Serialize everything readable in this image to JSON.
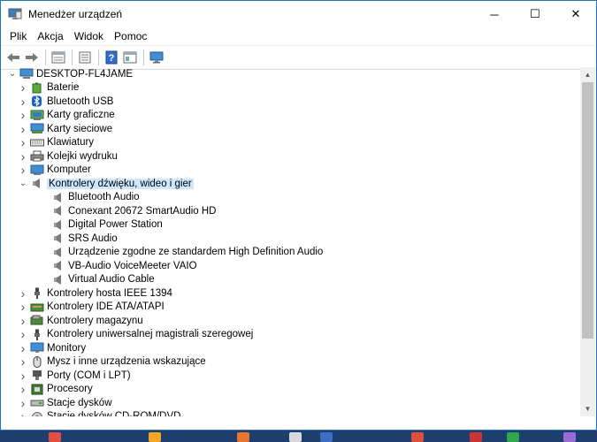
{
  "window": {
    "title": "Menedżer urządzeń"
  },
  "caption": {
    "minimize": "─",
    "maximize": "☐",
    "close": "✕"
  },
  "menu": [
    "Plik",
    "Akcja",
    "Widok",
    "Pomoc"
  ],
  "toolbar": [
    "back-icon",
    "forward-icon",
    "properties-view-icon",
    "details-icon",
    "help-icon",
    "action-icon",
    "monitor-icon"
  ],
  "tree": {
    "root": "DESKTOP-FL4JAME",
    "items": [
      {
        "label": "Baterie",
        "icon": "battery-icon",
        "expanded": false
      },
      {
        "label": "Bluetooth USB",
        "icon": "bluetooth-icon",
        "expanded": false
      },
      {
        "label": "Karty graficzne",
        "icon": "display-adapter-icon",
        "expanded": false
      },
      {
        "label": "Karty sieciowe",
        "icon": "network-adapter-icon",
        "expanded": false
      },
      {
        "label": "Klawiatury",
        "icon": "keyboard-icon",
        "expanded": false
      },
      {
        "label": "Kolejki wydruku",
        "icon": "printer-icon",
        "expanded": false
      },
      {
        "label": "Komputer",
        "icon": "computer-icon",
        "expanded": false
      },
      {
        "label": "Kontrolery dźwięku, wideo i gier",
        "icon": "speaker-icon",
        "expanded": true,
        "selected": true,
        "children": [
          "Bluetooth Audio",
          "Conexant 20672 SmartAudio HD",
          "Digital Power Station",
          "SRS Audio",
          "Urządzenie zgodne ze standardem High Definition Audio",
          "VB-Audio VoiceMeeter VAIO",
          "Virtual Audio Cable"
        ]
      },
      {
        "label": "Kontrolery hosta IEEE 1394",
        "icon": "ieee1394-icon",
        "expanded": false
      },
      {
        "label": "Kontrolery IDE ATA/ATAPI",
        "icon": "ide-controller-icon",
        "expanded": false
      },
      {
        "label": "Kontrolery magazynu",
        "icon": "storage-controller-icon",
        "expanded": false
      },
      {
        "label": "Kontrolery uniwersalnej magistrali szeregowej",
        "icon": "usb-icon",
        "expanded": false
      },
      {
        "label": "Monitory",
        "icon": "monitor-icon",
        "expanded": false
      },
      {
        "label": "Mysz i inne urządzenia wskazujące",
        "icon": "mouse-icon",
        "expanded": false
      },
      {
        "label": "Porty (COM i LPT)",
        "icon": "port-icon",
        "expanded": false
      },
      {
        "label": "Procesory",
        "icon": "processor-icon",
        "expanded": false
      },
      {
        "label": "Stacje dysków",
        "icon": "disk-drive-icon",
        "expanded": false
      },
      {
        "label": "Stacje dysków CD-ROM/DVD",
        "icon": "dvd-drive-icon",
        "expanded": false
      }
    ]
  },
  "colors": {
    "selection": "#cce8ff",
    "border": "#1b74c9",
    "taskbar": "#1e3e6e"
  }
}
